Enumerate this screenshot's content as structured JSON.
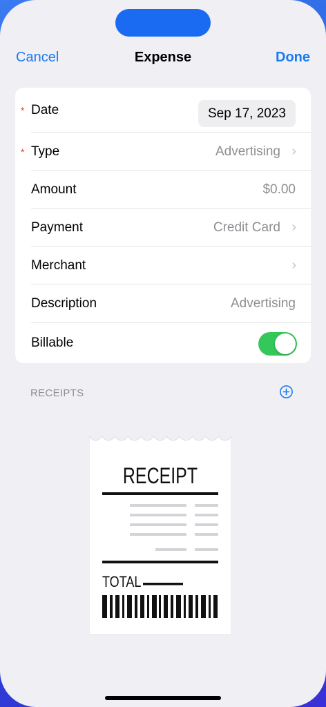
{
  "nav": {
    "cancel_label": "Cancel",
    "title": "Expense",
    "done_label": "Done"
  },
  "form": {
    "required_marker": "*",
    "date": {
      "label": "Date",
      "value": "Sep 17, 2023"
    },
    "type": {
      "label": "Type",
      "value": "Advertising"
    },
    "amount": {
      "label": "Amount",
      "value": "$0.00"
    },
    "payment": {
      "label": "Payment",
      "value": "Credit Card"
    },
    "merchant": {
      "label": "Merchant",
      "value": ""
    },
    "description": {
      "label": "Description",
      "placeholder": "Advertising"
    },
    "billable": {
      "label": "Billable",
      "on": true
    }
  },
  "receipts": {
    "header": "RECEIPTS",
    "image": {
      "title": "RECEIPT",
      "total_label": "TOTAL"
    }
  },
  "colors": {
    "accent": "#1a7bf0",
    "toggle_on": "#34c759",
    "required": "#e53935"
  },
  "icons": {
    "chevron": "›",
    "add": "plus-circle-icon"
  }
}
